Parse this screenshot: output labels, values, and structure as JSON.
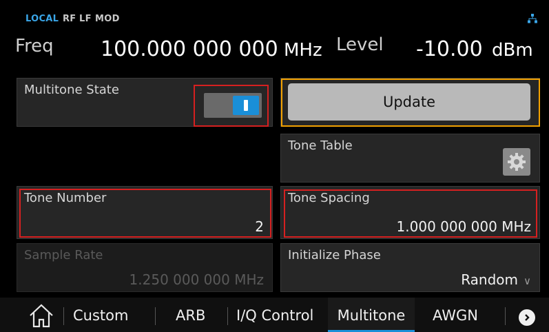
{
  "status": {
    "local": "LOCAL",
    "rf": "RF",
    "lf": "LF",
    "mod": "MOD"
  },
  "freq": {
    "label": "Freq",
    "value": "100.000 000 000",
    "unit": "MHz"
  },
  "level": {
    "label": "Level",
    "value": "-10.00",
    "unit": "dBm"
  },
  "multitone_state": {
    "label": "Multitone State",
    "on": true
  },
  "update": {
    "label": "Update"
  },
  "tone_table": {
    "label": "Tone Table",
    "icon": "gear-icon"
  },
  "tone_number": {
    "label": "Tone Number",
    "value": "2"
  },
  "tone_spacing": {
    "label": "Tone Spacing",
    "value": "1.000 000 000 MHz"
  },
  "sample_rate": {
    "label": "Sample Rate",
    "value": "1.250 000 000 MHz"
  },
  "initialize_phase": {
    "label": "Initialize Phase",
    "value": "Random"
  },
  "nav": {
    "home_icon": "home-icon",
    "items": [
      "Custom",
      "ARB",
      "I/Q Control",
      "Multitone",
      "AWGN"
    ],
    "active": "Multitone",
    "next_icon": "chevron-right-icon"
  },
  "colors": {
    "accent": "#1a8fd8",
    "highlight": "#f2a100",
    "error_frame": "#d62020",
    "local": "#3aa6e8"
  }
}
